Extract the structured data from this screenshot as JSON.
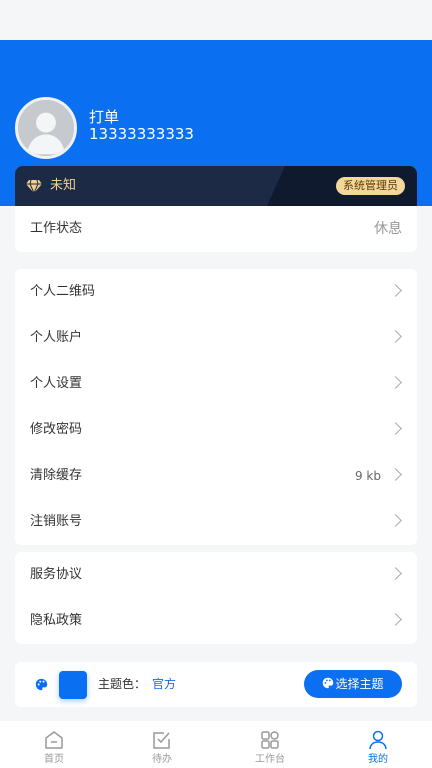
{
  "profile": {
    "name": "打单",
    "phone": "13333333333"
  },
  "vip": {
    "level": "未知",
    "role": "系统管理员"
  },
  "work_status": {
    "label": "工作状态",
    "value": "休息"
  },
  "menu": {
    "qr_code": "个人二维码",
    "account": "个人账户",
    "settings": "个人设置",
    "change_password": "修改密码",
    "clear_cache": "清除缓存",
    "cache_size": "9 kb",
    "deactivate": "注销账号"
  },
  "legal": {
    "service_agreement": "服务协议",
    "privacy_policy": "隐私政策"
  },
  "theme": {
    "label": "主题色：",
    "value": "官方",
    "button": "选择主题",
    "color": "#0b6ff2"
  },
  "tabbar": {
    "items": [
      {
        "label": "首页",
        "icon": "home-icon"
      },
      {
        "label": "待办",
        "icon": "todo-icon"
      },
      {
        "label": "工作台",
        "icon": "workbench-icon"
      },
      {
        "label": "我的",
        "icon": "user-icon"
      }
    ],
    "active_index": 3
  },
  "colors": {
    "primary": "#0b6ff2",
    "gold": "#f2d08e",
    "background": "#f5f6f8"
  }
}
